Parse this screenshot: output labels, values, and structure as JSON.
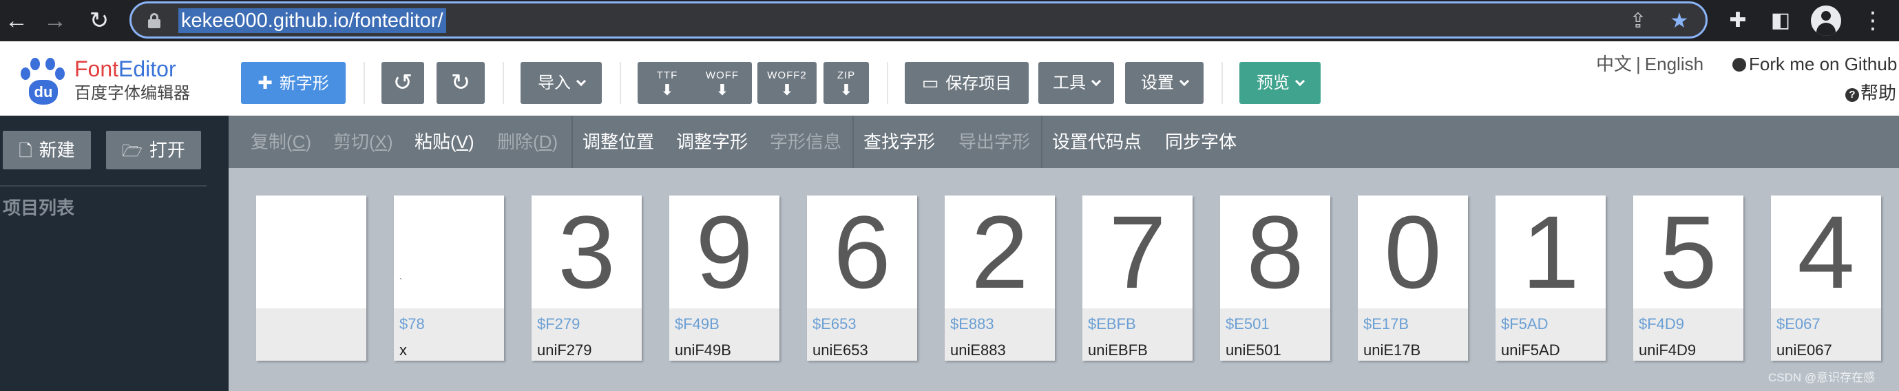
{
  "browser": {
    "url": "kekee000.github.io/fonteditor/"
  },
  "brand": {
    "logo_text": "du",
    "name_part1": "Font",
    "name_part2": "Editor",
    "subtitle": "百度字体编辑器"
  },
  "toolbar": {
    "new_glyph": "新字形",
    "import": "导入",
    "formats": [
      {
        "label": "TTF"
      },
      {
        "label": "WOFF"
      },
      {
        "label": "WOFF2"
      },
      {
        "label": "ZIP"
      }
    ],
    "save_project": "保存项目",
    "tools": "工具",
    "settings": "设置",
    "preview": "预览"
  },
  "header_right": {
    "lang_zh": "中文",
    "lang_sep": "|",
    "lang_en": "English",
    "github": "Fork me on Github",
    "help": "帮助"
  },
  "sidebar": {
    "new_label": "新建",
    "open_label": "打开",
    "list_title": "项目列表"
  },
  "editbar": {
    "copy": "复制(",
    "copy_key": "C",
    "copy_end": ")",
    "cut": "剪切(",
    "cut_key": "X",
    "cut_end": ")",
    "paste": "粘贴(",
    "paste_key": "V",
    "paste_end": ")",
    "delete": "删除(",
    "delete_key": "D",
    "delete_end": ")",
    "adjust_position": "调整位置",
    "adjust_glyph": "调整字形",
    "glyph_info": "字形信息",
    "find_glyph": "查找字形",
    "export_glyph": "导出字形",
    "set_codepoint": "设置代码点",
    "sync_font": "同步字体"
  },
  "glyphs": [
    {
      "char": "",
      "code": "",
      "name": ""
    },
    {
      "char": "",
      "code": "$78",
      "name": "x"
    },
    {
      "char": "3",
      "code": "$F279",
      "name": "uniF279"
    },
    {
      "char": "9",
      "code": "$F49B",
      "name": "uniF49B"
    },
    {
      "char": "6",
      "code": "$E653",
      "name": "uniE653"
    },
    {
      "char": "2",
      "code": "$E883",
      "name": "uniE883"
    },
    {
      "char": "7",
      "code": "$EBFB",
      "name": "uniEBFB"
    },
    {
      "char": "8",
      "code": "$E501",
      "name": "uniE501"
    },
    {
      "char": "0",
      "code": "$E17B",
      "name": "uniE17B"
    },
    {
      "char": "1",
      "code": "$F5AD",
      "name": "uniF5AD"
    },
    {
      "char": "5",
      "code": "$F4D9",
      "name": "uniF4D9"
    },
    {
      "char": "4",
      "code": "$E067",
      "name": "uniE067"
    }
  ],
  "watermark": "CSDN @意识存在感",
  "colors": {
    "primary_blue": "#4a90e2",
    "toolbar_gray": "#6d7780",
    "preview_teal": "#3fa38e",
    "sidebar_dark": "#212b35",
    "code_blue": "#6a9fd4"
  }
}
